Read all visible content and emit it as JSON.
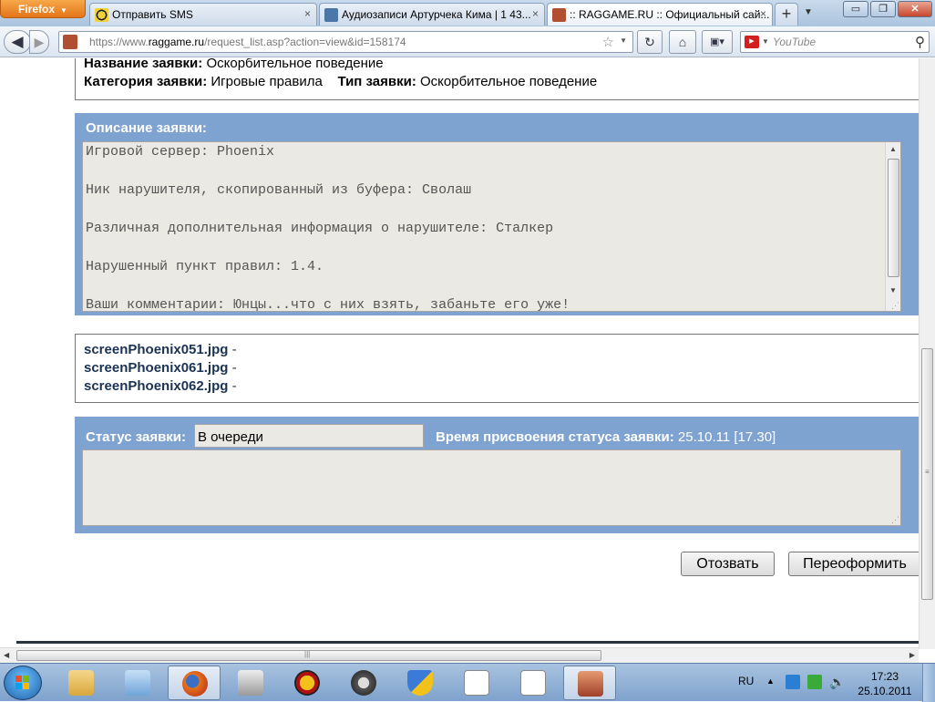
{
  "browser": {
    "menu_label": "Firefox",
    "tabs": [
      {
        "title": "Отправить SMS",
        "close": "×"
      },
      {
        "title": "Аудиозаписи Артурчека Кима | 1 43...",
        "close": "×"
      },
      {
        "title": ":: RAGGAME.RU :: Официальный сай...",
        "close": "×"
      }
    ],
    "new_tab": "+",
    "url_prefix": "https://www.",
    "url_domain": "raggame.ru",
    "url_path": "/request_list.asp?action=view&id=158174",
    "search_placeholder": "YouTube",
    "window_controls": {
      "minimize": "▭",
      "maximize": "❐",
      "close": "✕"
    }
  },
  "request": {
    "name_label": "Название заявки:",
    "name_value": "Оскорбительное поведение",
    "category_label": "Категория заявки:",
    "category_value": "Игровые правила",
    "type_label": "Тип заявки:",
    "type_value": "Оскорбительное поведение",
    "description_title": "Описание заявки:",
    "description_lines": [
      "Игровой сервер: Phoenix",
      "Ник нарушителя, скопированный из буфера: Сволаш",
      "Различная дополнительная информация о нарушителе: Сталкер",
      "Нарушенный пункт правил: 1.4.",
      "Ваши комментарии: Юнцы...что с них взять, забаньте его уже!"
    ],
    "attachments": [
      {
        "name": "screenPhoenix051.jpg",
        "sep": "-"
      },
      {
        "name": "screenPhoenix061.jpg",
        "sep": "-"
      },
      {
        "name": "screenPhoenix062.jpg",
        "sep": "-"
      }
    ],
    "status_label": "Статус заявки:",
    "status_value": "В очереди",
    "status_time_label": "Время присвоения статуса заявки:",
    "status_time_value": "25.10.11 [17.30]",
    "buttons": {
      "withdraw": "Отозвать",
      "reissue": "Переоформить"
    }
  },
  "taskbar": {
    "language": "RU",
    "time": "17:23",
    "date": "25.10.2011"
  },
  "colors": {
    "panel_blue": "#7fa3d1",
    "field_bg": "#ebe9e3",
    "firefox_orange": "#e4741a"
  }
}
